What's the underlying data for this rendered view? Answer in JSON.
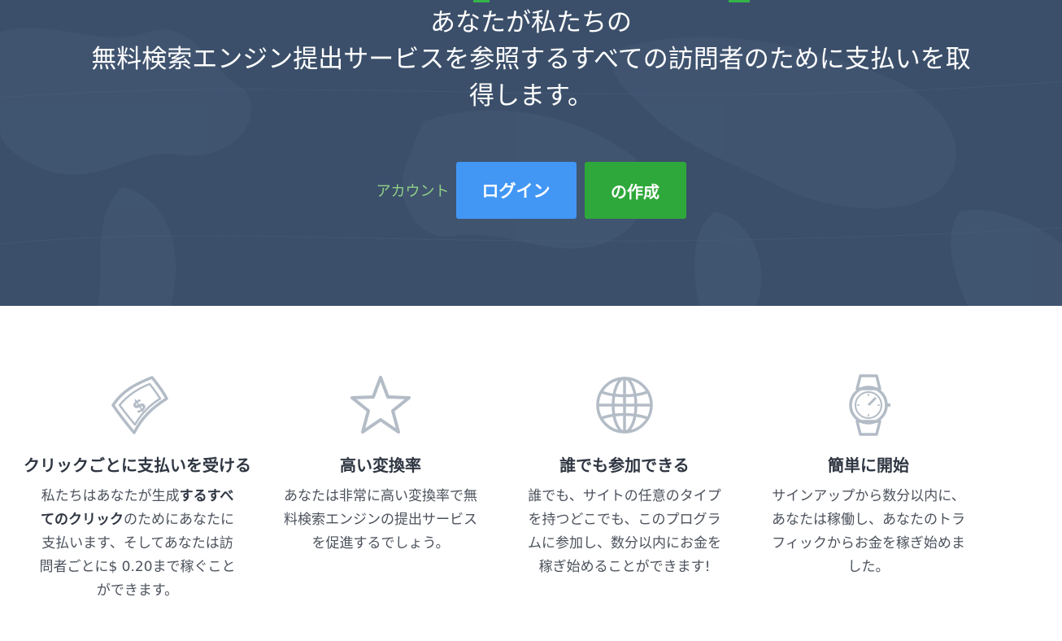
{
  "hero": {
    "title_line1": "あなたが私たちの",
    "title_line2": "無料検索エンジン提出サービスを参照するすべての訪問者のために支払いを取",
    "title_line3": "得します。",
    "account_label": "アカウント",
    "login_button": "ログイン",
    "create_button": "の作成"
  },
  "features": [
    {
      "icon": "money-bill-icon",
      "title": "クリックごとに支払いを受ける",
      "text_pre": "私たちはあなたが生成",
      "text_bold": "するすべてのクリック",
      "text_post": "のためにあなたに支払います、そしてあなたは訪問者ごとに$ 0.20まで稼ぐことができます。"
    },
    {
      "icon": "star-icon",
      "title": "高い変換率",
      "text": "あなたは非常に高い変換率で無料検索エンジンの提出サービスを促進するでしょう。"
    },
    {
      "icon": "globe-icon",
      "title": "誰でも参加できる",
      "text": "誰でも、サイトの任意のタイプを持つどこでも、このプログラムに参加し、数分以内にお金を稼ぎ始めることができます!"
    },
    {
      "icon": "watch-icon",
      "title": "簡単に開始",
      "text": "サインアップから数分以内に、あなたは稼働し、あなたのトラフィックからお金を稼ぎ始めました。"
    }
  ],
  "colors": {
    "hero_bg": "#3b4f6a",
    "login_blue": "#4297f5",
    "create_green": "#2ea83a",
    "account_label_green": "#8fcf86",
    "icon_gray": "#b3bcc6"
  }
}
